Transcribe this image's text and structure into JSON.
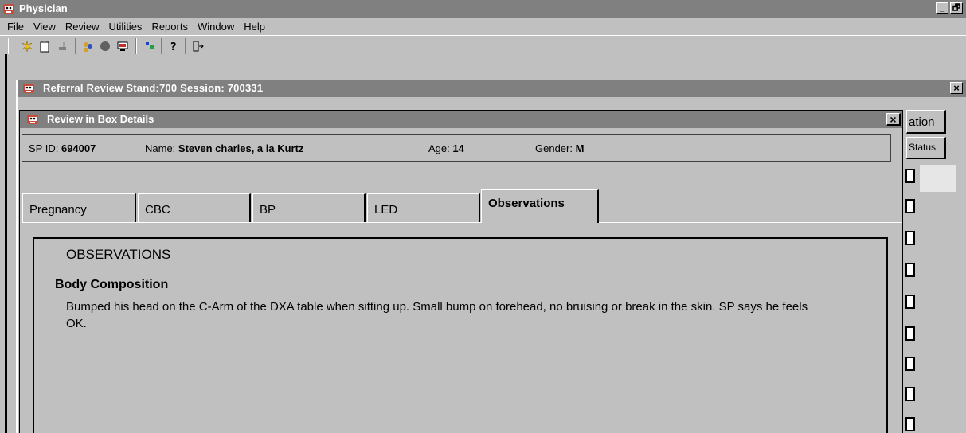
{
  "app": {
    "title": "Physician",
    "min_glyph": "_",
    "max_glyph": "🗗"
  },
  "menu": [
    "File",
    "View",
    "Review",
    "Utilities",
    "Reports",
    "Window",
    "Help"
  ],
  "toolbar_icons": [
    "new-icon",
    "clipboard-icon",
    "stamp-icon",
    "users-icon",
    "stop-icon",
    "monitor-icon",
    "flag-icon",
    "help-icon",
    "exit-icon"
  ],
  "referral_window": {
    "title": "Referral Review Stand:700 Session: 700331",
    "close_glyph": "×"
  },
  "background": {
    "button1": "ation",
    "button2": "Status"
  },
  "review_window": {
    "title": "Review in Box Details",
    "close_glyph": "×"
  },
  "sp_info": {
    "sp_id_label": "SP ID:",
    "sp_id": "694007",
    "name_label": "Name:",
    "name": "Steven charles, a la Kurtz",
    "age_label": "Age:",
    "age": "14",
    "gender_label": "Gender:",
    "gender": "M"
  },
  "tabs": [
    "Pregnancy",
    "CBC",
    "BP",
    "LED",
    "Observations"
  ],
  "active_tab": "Observations",
  "observations": {
    "heading": "OBSERVATIONS",
    "section": "Body Composition",
    "text": "Bumped his head on the C-Arm of the DXA table when sitting up.  Small bump on forehead, no bruising or break in the skin.  SP says he feels OK."
  },
  "colors": {
    "title_bar": "#808080",
    "window_face": "#c0c0c0"
  }
}
